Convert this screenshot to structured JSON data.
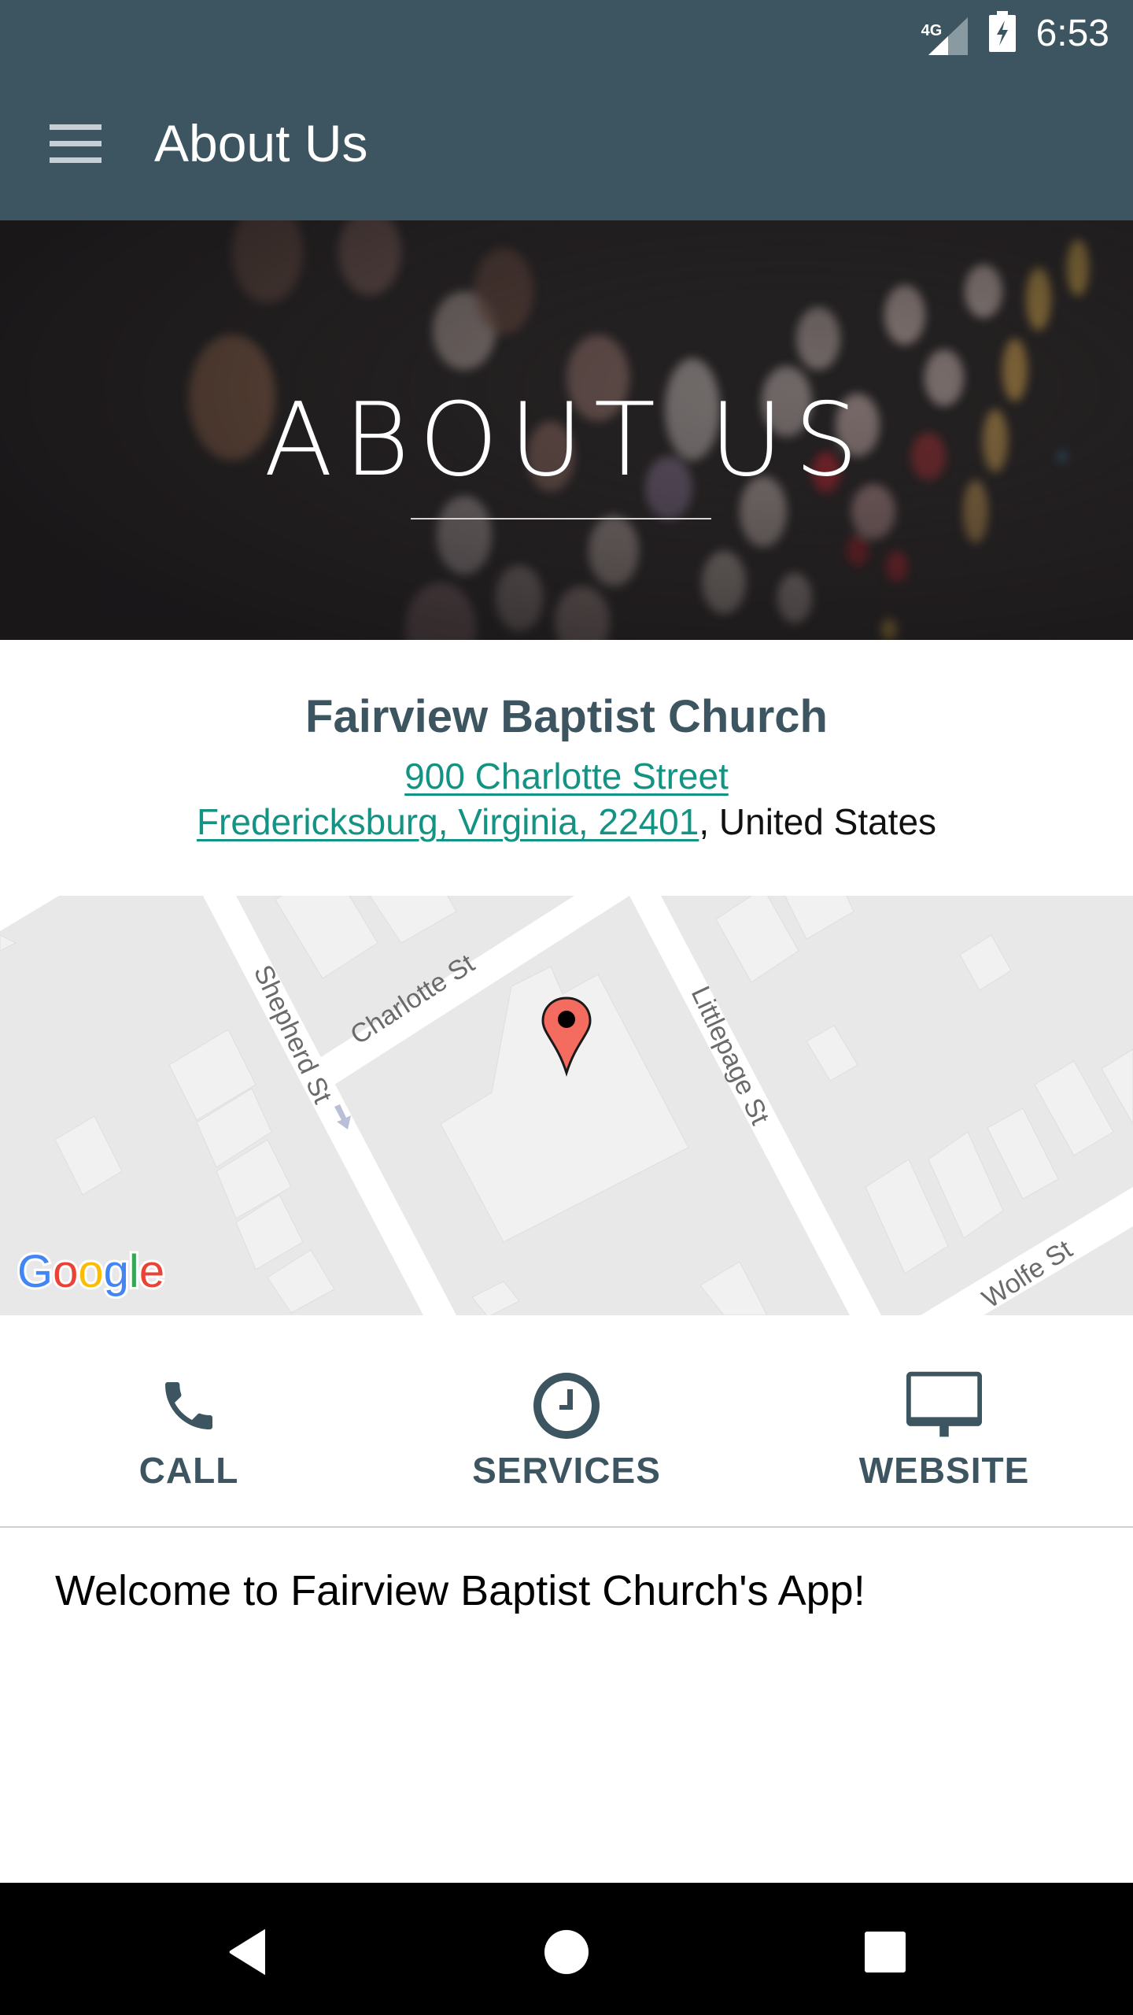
{
  "status_bar": {
    "network": "4G",
    "time": "6:53",
    "icons": [
      "signal-icon",
      "battery-charging-icon"
    ]
  },
  "app_bar": {
    "title": "About Us",
    "menu_icon": "hamburger-menu-icon"
  },
  "hero": {
    "title": "ABOUT US"
  },
  "church": {
    "name": "Fairview Baptist Church",
    "address_line1": "900 Charlotte Street",
    "address_line2_link": "Fredericksburg, Virginia, 22401",
    "address_line2_suffix": ", United States",
    "link_color": "#139383",
    "name_color": "#3c5560"
  },
  "map": {
    "streets": [
      "Shepherd St",
      "Charlotte St",
      "Littlepage St",
      "Wolfe St"
    ],
    "attribution": "Google",
    "marker_color": "#f46b5f"
  },
  "actions": [
    {
      "label": "CALL",
      "icon": "phone-icon"
    },
    {
      "label": "SERVICES",
      "icon": "clock-icon"
    },
    {
      "label": "WEBSITE",
      "icon": "desktop-monitor-icon"
    }
  ],
  "welcome_text": "Welcome to Fairview Baptist Church's App!",
  "nav_bar": {
    "buttons": [
      "back",
      "home",
      "recents"
    ]
  },
  "theme": {
    "primary": "#3c5560",
    "accent": "#139383"
  }
}
